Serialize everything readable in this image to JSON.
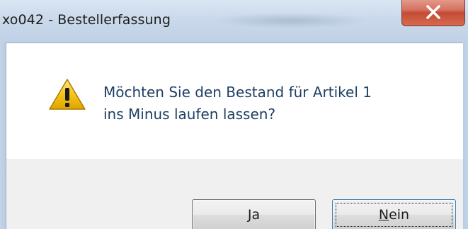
{
  "window": {
    "title": "xo042 - Bestellerfassung",
    "close_icon": "close-icon"
  },
  "dialog": {
    "icon": "warning-icon",
    "message_line1": "Möchten Sie den Bestand für Artikel 1",
    "message_line2": "ins Minus laufen lassen?"
  },
  "buttons": {
    "yes": {
      "mnemonic": "J",
      "rest": "a"
    },
    "no": {
      "mnemonic": "N",
      "rest": "ein",
      "focused": true
    }
  },
  "colors": {
    "message_text": "#1e3f63",
    "warning_yellow": "#f5c518",
    "close_red": "#c44b35"
  }
}
